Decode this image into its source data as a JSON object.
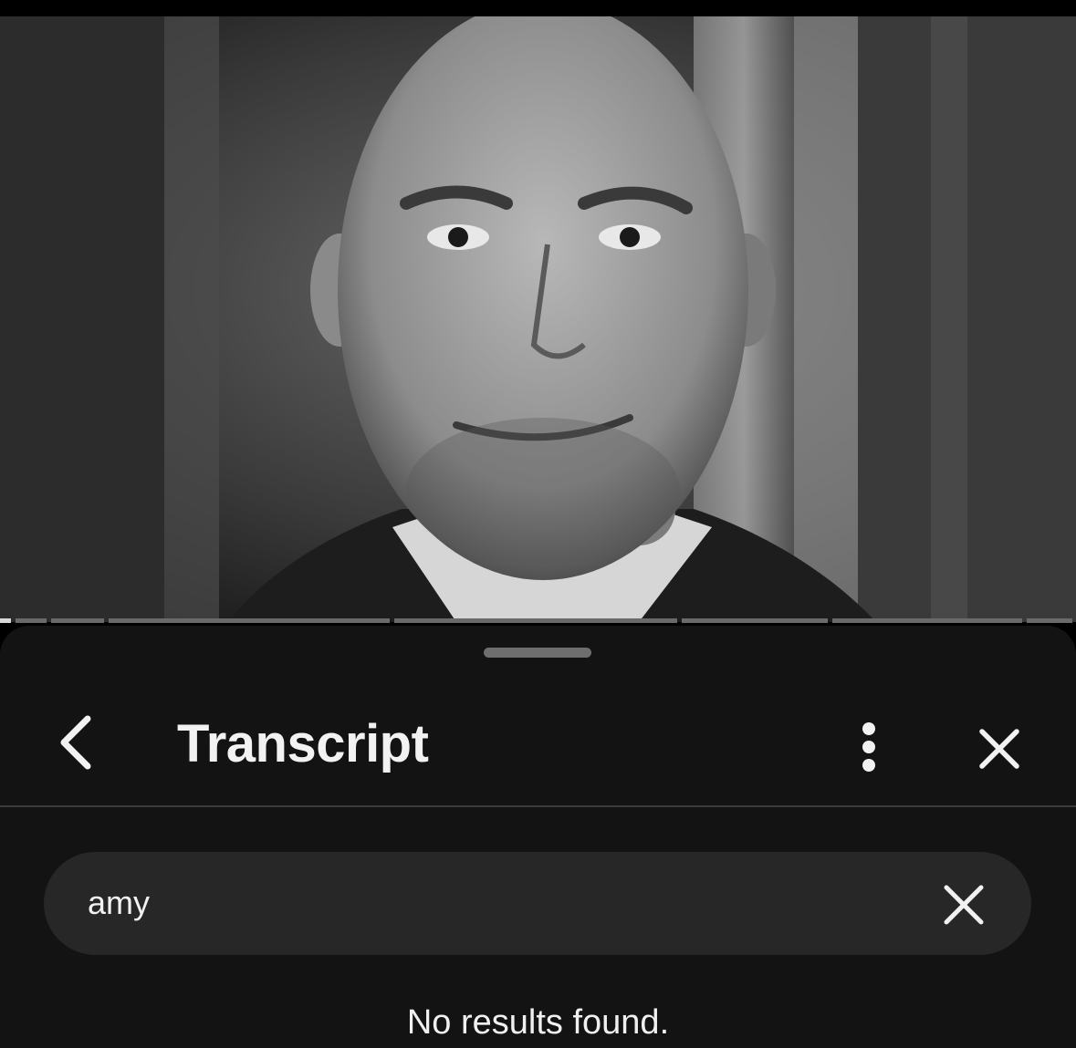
{
  "video": {
    "thumbnail_icon": "video-frame-image"
  },
  "transcript_panel": {
    "title": "Transcript",
    "back_icon": "chevron-left-icon",
    "more_icon": "more-vertical-icon",
    "close_icon": "close-icon"
  },
  "search": {
    "value": "amy",
    "clear_icon": "close-icon"
  },
  "results": {
    "empty_message": "No results found."
  },
  "colors": {
    "background": "#000000",
    "sheet": "#131313",
    "search_field": "#272727",
    "text": "#f2f2f2",
    "divider": "#3a3a3a"
  }
}
